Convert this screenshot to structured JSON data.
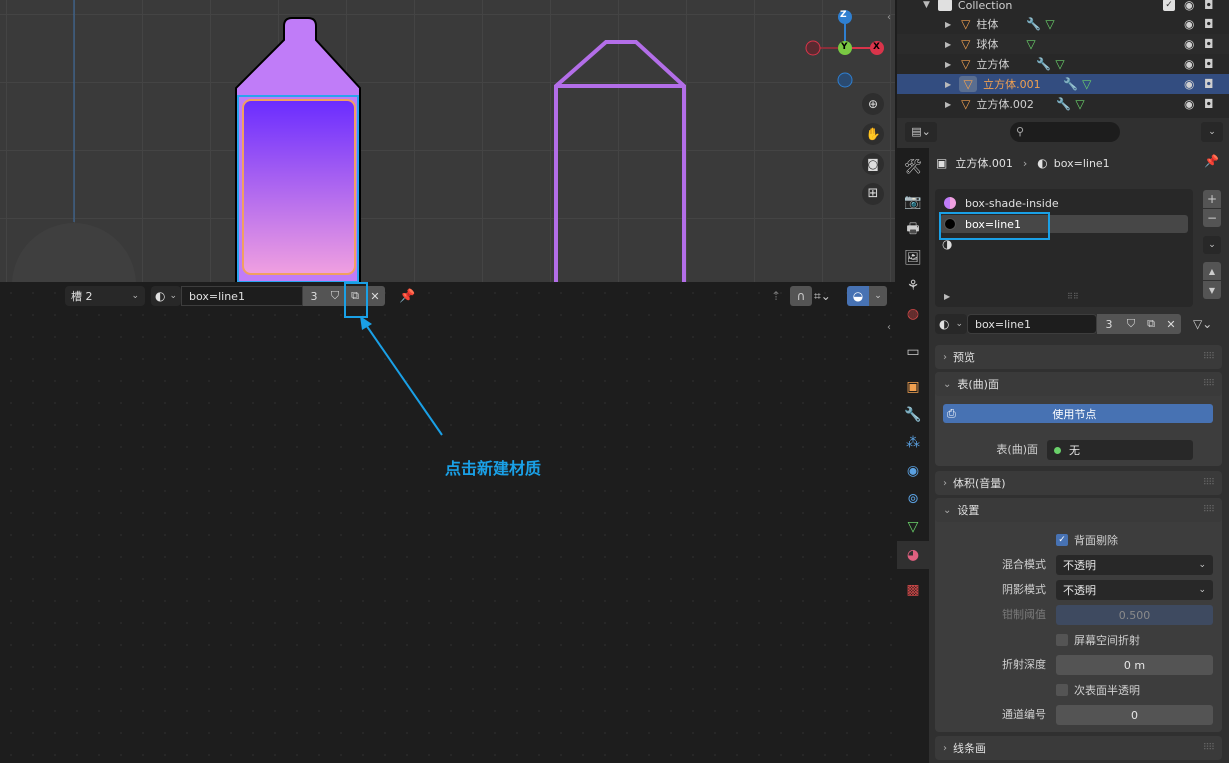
{
  "viewport": {
    "gizmo": {
      "z": "Z",
      "y": "Y",
      "x": "X"
    },
    "colors": {
      "bottle_top": "#c084fc",
      "screen_top": "#6a2cff",
      "screen_bottom": "#f0a0e0",
      "outline_obj": "#b36ee8"
    }
  },
  "node_header": {
    "slot": "槽 2",
    "material_name": "box=line1",
    "user_count": "3"
  },
  "annotation": {
    "text": "点击新建材质",
    "color": "#1aa0e6"
  },
  "outliner": {
    "collection": "Collection",
    "items": [
      {
        "name": "柱体",
        "selected": false
      },
      {
        "name": "球体",
        "selected": false
      },
      {
        "name": "立方体",
        "selected": false
      },
      {
        "name": "立方体.001",
        "selected": true
      },
      {
        "name": "立方体.002",
        "selected": false
      }
    ]
  },
  "properties": {
    "breadcrumb_object": "立方体.001",
    "breadcrumb_material": "box=line1",
    "slots": [
      {
        "name": "box-shade-inside"
      },
      {
        "name": "box=line1"
      }
    ],
    "material_name": "box=line1",
    "user_count": "3",
    "panels": {
      "preview": "预览",
      "surface": "表(曲)面",
      "use_nodes": "使用节点",
      "surface_label": "表(曲)面",
      "surface_value": "无",
      "volume": "体积(音量)",
      "settings": "设置",
      "lineart": "线条画"
    },
    "settings": {
      "backface_culling": "背面剔除",
      "blend_mode_label": "混合模式",
      "blend_mode_value": "不透明",
      "shadow_mode_label": "阴影模式",
      "shadow_mode_value": "不透明",
      "clip_threshold_label": "钳制阈值",
      "clip_threshold_value": "0.500",
      "ssr": "屏幕空间折射",
      "refraction_depth_label": "折射深度",
      "refraction_depth_value": "0 m",
      "sss": "次表面半透明",
      "pass_index_label": "通道编号",
      "pass_index_value": "0"
    }
  }
}
